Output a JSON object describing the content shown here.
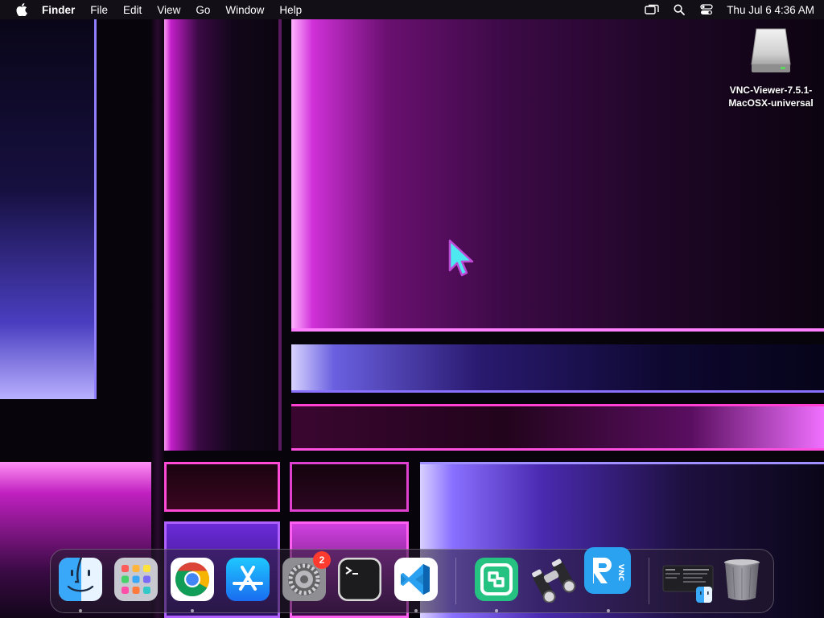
{
  "menubar": {
    "apple_icon": "apple-logo-icon",
    "app_name": "Finder",
    "menus": [
      "File",
      "Edit",
      "View",
      "Go",
      "Window",
      "Help"
    ],
    "status_icons": [
      "screen-mirroring-icon",
      "spotlight-search-icon",
      "control-center-icon"
    ],
    "clock": "Thu Jul 6  4:36 AM"
  },
  "desktop": {
    "items": [
      {
        "label": "VNC-Viewer-7.5.1-MacOSX-universal",
        "icon": "disk-image-icon"
      }
    ]
  },
  "dock": {
    "apps": [
      {
        "name": "Finder",
        "icon": "finder-icon",
        "running": true
      },
      {
        "name": "Launchpad",
        "icon": "launchpad-icon",
        "running": false
      },
      {
        "name": "Google Chrome",
        "icon": "chrome-icon",
        "running": true
      },
      {
        "name": "App Store",
        "icon": "app-store-icon",
        "running": false
      },
      {
        "name": "System Settings",
        "icon": "system-settings-icon",
        "running": false,
        "badge": "2"
      },
      {
        "name": "Terminal",
        "icon": "terminal-icon",
        "running": false
      },
      {
        "name": "Visual Studio Code",
        "icon": "vscode-icon",
        "running": true
      },
      {
        "name": "App",
        "icon": "green-app-icon",
        "running": true
      },
      {
        "name": "Binoculars App",
        "icon": "binoculars-icon",
        "running": false
      },
      {
        "name": "RealVNC Viewer",
        "icon": "vnc-viewer-icon",
        "running": true
      },
      {
        "name": "Recent Window",
        "icon": "window-thumbnail-icon",
        "running": false
      },
      {
        "name": "Trash",
        "icon": "trash-icon",
        "running": false
      }
    ]
  },
  "colors": {
    "menubar_bg": "#141018",
    "accent_pink": "#ff60f0",
    "accent_purple": "#8a70ff",
    "badge_red": "#ff3b30",
    "cursor_cyan": "#4de8f0"
  }
}
